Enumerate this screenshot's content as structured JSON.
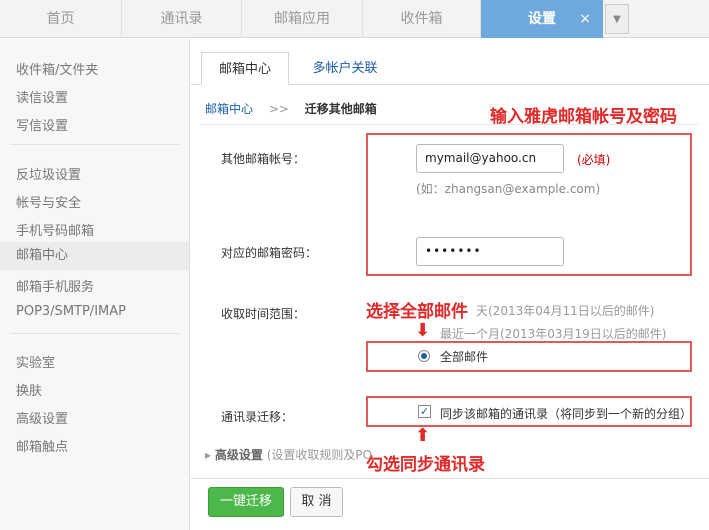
{
  "top_tabs": [
    {
      "label": "首页"
    },
    {
      "label": "通讯录"
    },
    {
      "label": "邮箱应用"
    },
    {
      "label": "收件箱"
    },
    {
      "label": "设置",
      "close": "×"
    }
  ],
  "tab_menu_icon": "chevron-down-icon",
  "sidebar": {
    "items": [
      {
        "label": "收件箱/文件夹"
      },
      {
        "label": "读信设置"
      },
      {
        "label": "写信设置"
      },
      {
        "label": "反垃圾设置"
      },
      {
        "label": "帐号与安全"
      },
      {
        "label": "手机号码邮箱"
      },
      {
        "label": "邮箱中心"
      },
      {
        "label": "邮箱手机服务"
      },
      {
        "label": "POP3/SMTP/IMAP"
      },
      {
        "label": "实验室"
      },
      {
        "label": "换肤"
      },
      {
        "label": "高级设置"
      },
      {
        "label": "邮箱触点"
      }
    ]
  },
  "content_tabs": [
    {
      "label": "邮箱中心"
    },
    {
      "label": "多帐户关联"
    }
  ],
  "breadcrumb": {
    "link": "邮箱中心",
    "sep": ">>",
    "current": "迁移其他邮箱"
  },
  "form": {
    "account_label": "其他邮箱帐号：",
    "account_value": "mymail@yahoo.cn",
    "required": "(必填)",
    "account_hint": "(如：zhangsan@example.com)",
    "password_label": "对应的邮箱密码：",
    "password_value": "•••••••",
    "range_label": "收取时间范围：",
    "range_opt1": "天(2013年04月11日以后的邮件)",
    "range_opt2": "最近一个月(2013年03月19日以后的邮件)",
    "range_opt3": "全部邮件",
    "contacts_label": "通讯录迁移：",
    "contacts_check": "✓",
    "contacts_text": "同步该邮箱的通讯录（将同步到一个新的分组）",
    "advanced_title": "高级设置",
    "advanced_desc": "(设置收取规则及PO"
  },
  "callouts": {
    "top": "输入雅虎邮箱帐号及密码",
    "middle": "选择全部邮件",
    "bottom": "勾选同步通讯录"
  },
  "buttons": {
    "migrate": "一键迁移",
    "cancel": "取 消"
  },
  "colors": {
    "accent": "#6fa8dc",
    "annotation": "#e02a2a",
    "primary_button": "#4db84a",
    "link": "#1b5ea7"
  }
}
